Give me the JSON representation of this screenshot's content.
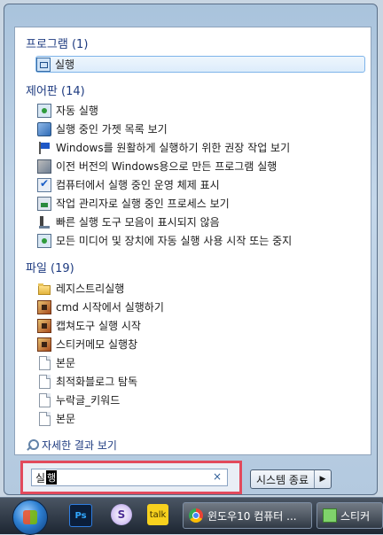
{
  "sections": {
    "programs": {
      "title": "프로그램 (1)",
      "items": [
        {
          "label": "실행",
          "icon": "run-dialog-icon"
        }
      ]
    },
    "control_panel": {
      "title": "제어판 (14)",
      "items": [
        {
          "label": "자동 실행",
          "icon": "autoplay-icon"
        },
        {
          "label": "실행 중인 가젯 목록 보기",
          "icon": "gadgets-icon"
        },
        {
          "label": "Windows를 원활하게 실행하기 위한 권장 작업 보기",
          "icon": "action-center-flag-icon"
        },
        {
          "label": "이전 버전의 Windows용으로 만든 프로그램 실행",
          "icon": "compatibility-icon"
        },
        {
          "label": "컴퓨터에서 실행 중인 운영 체제 표시",
          "icon": "system-check-icon"
        },
        {
          "label": "작업 관리자로 실행 중인 프로세스 보기",
          "icon": "task-manager-icon"
        },
        {
          "label": "빠른 실행 도구 모음이 표시되지 않음",
          "icon": "taskbar-icon"
        },
        {
          "label": "모든 미디어 및 장치에 자동 실행 사용 시작 또는 중지",
          "icon": "media-autoplay-icon"
        }
      ]
    },
    "files": {
      "title": "파일 (19)",
      "items": [
        {
          "label": "레지스트리실행",
          "icon": "folder-icon"
        },
        {
          "label": "cmd 시작에서 실행하기",
          "icon": "image-file-icon"
        },
        {
          "label": "캡쳐도구 실행 시작",
          "icon": "image-file-icon"
        },
        {
          "label": "스티커메모 실행창",
          "icon": "image-file-icon"
        },
        {
          "label": "본문",
          "icon": "document-icon"
        },
        {
          "label": "최적화블로그 탐독",
          "icon": "document-icon"
        },
        {
          "label": "누락글_키워드",
          "icon": "document-icon"
        },
        {
          "label": "본문",
          "icon": "document-icon"
        }
      ]
    }
  },
  "more_results": "자세한 결과 보기",
  "search": {
    "typed": "실",
    "composing": "행",
    "clear": "×"
  },
  "shutdown": {
    "label": "시스템 종료",
    "arrow": "▶"
  },
  "taskbar": {
    "photoshop": "Ps",
    "s_app": "S",
    "chat": "talk",
    "chrome_task": "윈도우10 컴퓨터 ...",
    "sticky_task": "스티커"
  },
  "colors": {
    "highlight_border": "#7eb4ea",
    "search_outline": "#e24a5c",
    "section_title": "#1e3b80"
  }
}
